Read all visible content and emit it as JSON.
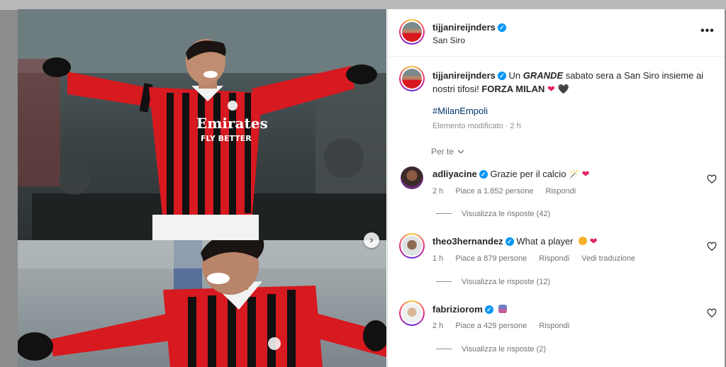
{
  "post": {
    "author": "tijjanireijnders",
    "location": "San Siro",
    "caption": {
      "before": "Un ",
      "emphasis": "GRANDE",
      "after": " sabato sera a San Siro insieme ai nostri tifosi! ",
      "bold": "FORZA MILAN",
      "hearts": [
        "❤",
        "🖤"
      ]
    },
    "hashtag": "#MilanEmpoli",
    "edited": "Elemento modificato · 2 h"
  },
  "sort_label": "Per te",
  "comments": [
    {
      "user": "adliyacine",
      "text": "Grazie per il calcio",
      "time": "2 h",
      "likes": "Piace a 1.852 persone",
      "reply": "Rispondi",
      "view_replies": "Visualizza le risposte (42)"
    },
    {
      "user": "theo3hernandez",
      "text": "What a player",
      "time": "1 h",
      "likes": "Piace a 879 persone",
      "reply": "Rispondi",
      "translate": "Vedi traduzione",
      "view_replies": "Visualizza le risposte (12)"
    },
    {
      "user": "fabriziorom",
      "text": "",
      "time": "2 h",
      "likes": "Piace a 429 persone",
      "reply": "Rispondi",
      "view_replies": "Visualizza le risposte (2)"
    }
  ],
  "media": {
    "jersey_sponsor_line1": "Emirates",
    "jersey_sponsor_line2": "FLY BETTER",
    "next_icon": "chevron-right-icon"
  },
  "colors": {
    "milan_red": "#d71920",
    "milan_black": "#111111",
    "verified_blue": "#0095f6",
    "link_blue": "#00376b"
  }
}
